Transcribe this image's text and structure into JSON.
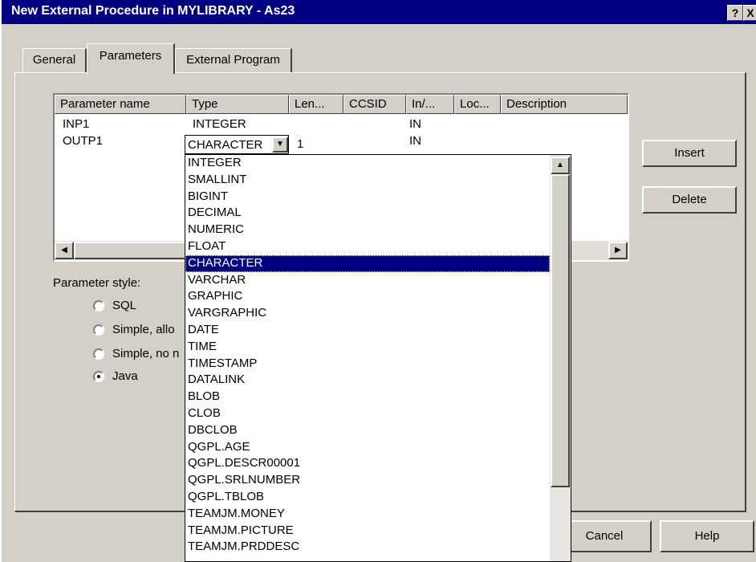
{
  "window": {
    "title": "New External Procedure in MYLIBRARY  - As23",
    "help_glyph": "?",
    "close_glyph": "X"
  },
  "tabs": [
    {
      "label": "General"
    },
    {
      "label": "Parameters"
    },
    {
      "label": "External Program"
    }
  ],
  "table": {
    "columns": [
      "Parameter name",
      "Type",
      "Len...",
      "CCSID",
      "In/...",
      "Loc...",
      "Description"
    ],
    "rows": [
      {
        "name": "INP1",
        "type": "INTEGER",
        "len": "",
        "in_out": "IN"
      },
      {
        "name": "OUTP1",
        "type": "CHARACTER",
        "len": "1",
        "in_out": "IN"
      }
    ]
  },
  "type_dropdown": {
    "selected": "CHARACTER",
    "options": [
      "INTEGER",
      "SMALLINT",
      "BIGINT",
      "DECIMAL",
      "NUMERIC",
      "FLOAT",
      "CHARACTER",
      "VARCHAR",
      "GRAPHIC",
      "VARGRAPHIC",
      "DATE",
      "TIME",
      "TIMESTAMP",
      "DATALINK",
      "BLOB",
      "CLOB",
      "DBCLOB",
      "QGPL.AGE",
      "QGPL.DESCR00001",
      "QGPL.SRLNUMBER",
      "QGPL.TBLOB",
      "TEAMJM.MONEY",
      "TEAMJM.PICTURE",
      "TEAMJM.PRDDESC"
    ],
    "highlighted_index": 6
  },
  "buttons": {
    "insert": "Insert",
    "delete": "Delete",
    "cancel": "Cancel",
    "help": "Help"
  },
  "parameter_style": {
    "label": "Parameter style:",
    "options": [
      {
        "label": "SQL",
        "checked": false
      },
      {
        "label": "Simple, allo",
        "checked": false
      },
      {
        "label": "Simple, no n",
        "checked": false
      },
      {
        "label": "Java",
        "checked": true
      }
    ]
  },
  "colors": {
    "title_bar": "#000080",
    "face": "#d4d0c8",
    "highlight": "#000080"
  }
}
